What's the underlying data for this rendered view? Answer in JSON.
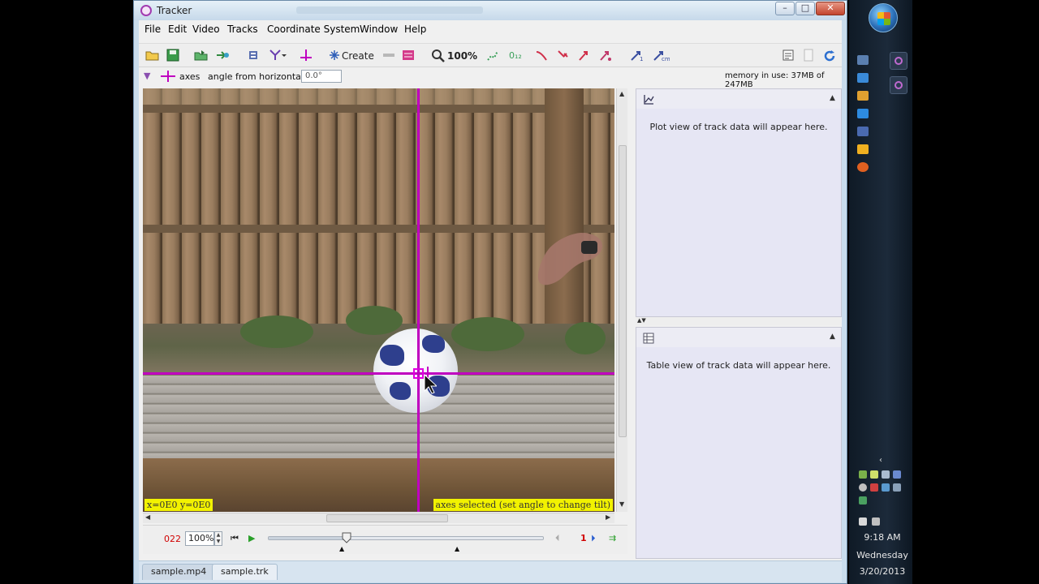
{
  "window": {
    "title": "Tracker"
  },
  "menu": [
    "File",
    "Edit",
    "Video",
    "Tracks",
    "Coordinate System",
    "Window",
    "Help"
  ],
  "toolbar": {
    "create_label": "Create",
    "zoom_label": "100%",
    "subscript_label": "0₁₂"
  },
  "propbar": {
    "track_name": "axes",
    "angle_label": "angle from horizontal",
    "angle_value": "0.0°",
    "memory": "memory in use: 37MB of 247MB"
  },
  "video": {
    "coords_readout": "x=0E0  y=0E0",
    "status_message": "axes selected (set angle to change tilt)"
  },
  "player": {
    "frame_number": "022",
    "rate": "100%",
    "step_size": "1",
    "slider_position_fraction": 0.285
  },
  "plot_panel": {
    "hint": "Plot view of track data will appear here."
  },
  "table_panel": {
    "hint": "Table view of track data will appear here."
  },
  "tabs": [
    "sample.mp4",
    "sample.trk"
  ],
  "taskbar": {
    "time": "9:18 AM",
    "day": "Wednesday",
    "date": "3/20/2013"
  },
  "colors": {
    "axes": "#c000c0",
    "readout_background": "#f2f200",
    "frame_number": "#d00000"
  },
  "icons": [
    "open-icon",
    "save-icon",
    "open-video-icon",
    "export-icon",
    "clip-settings-icon",
    "calibration-icon",
    "axes-icon",
    "create-track-icon",
    "zoom-icon",
    "refresh-icon"
  ]
}
